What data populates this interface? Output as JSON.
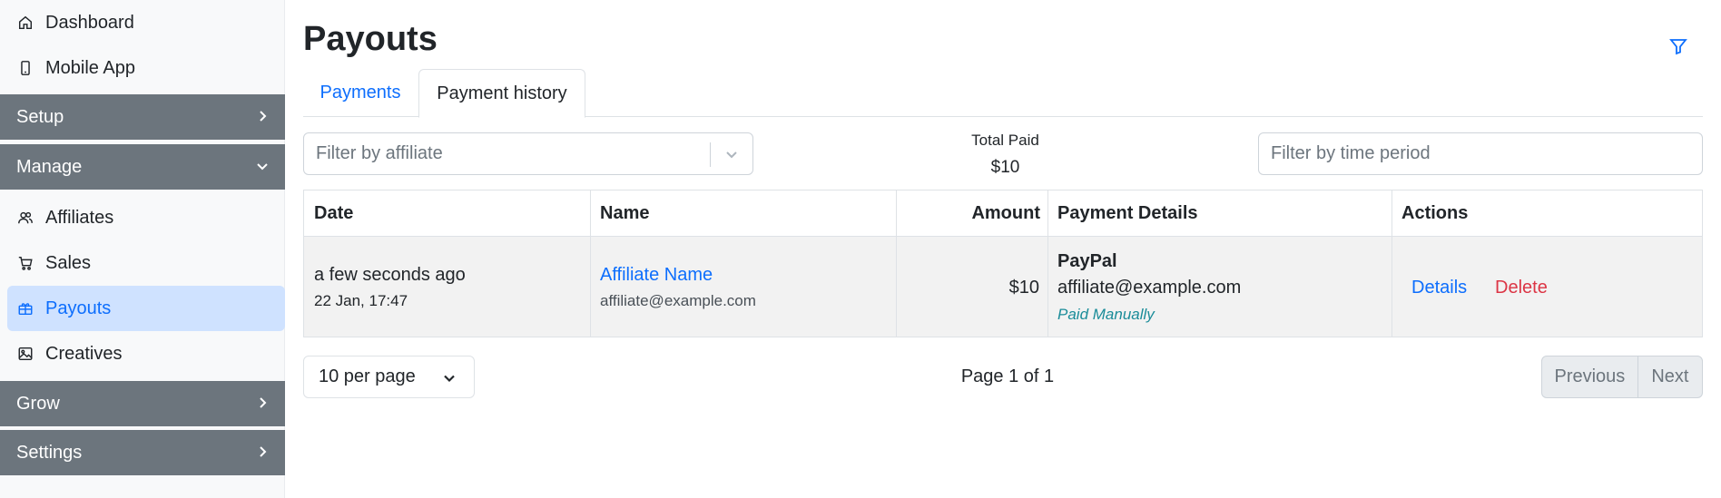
{
  "sidebar": {
    "dashboard": "Dashboard",
    "mobile_app": "Mobile App",
    "setup": "Setup",
    "manage": "Manage",
    "affiliates": "Affiliates",
    "sales": "Sales",
    "payouts": "Payouts",
    "creatives": "Creatives",
    "grow": "Grow",
    "settings": "Settings"
  },
  "page": {
    "title": "Payouts",
    "tabs": [
      "Payments",
      "Payment history"
    ],
    "active_tab": "Payment history"
  },
  "filters": {
    "affiliate_placeholder": "Filter by affiliate",
    "period_placeholder": "Filter by time period",
    "total_paid_label": "Total Paid",
    "total_paid_value": "$10"
  },
  "table": {
    "headers": [
      "Date",
      "Name",
      "Amount",
      "Payment Details",
      "Actions"
    ],
    "rows": [
      {
        "date_relative": "a few seconds ago",
        "date_exact": "22 Jan, 17:47",
        "name": "Affiliate Name",
        "email": "affiliate@example.com",
        "amount": "$10",
        "method": "PayPal",
        "method_account": "affiliate@example.com",
        "status": "Paid Manually",
        "actions": [
          "Details",
          "Delete"
        ]
      }
    ]
  },
  "pagination": {
    "per_page": "10 per page",
    "page_info": "Page 1 of 1",
    "previous": "Previous",
    "next": "Next"
  },
  "colors": {
    "accent": "#0d6efd",
    "danger": "#dc3545",
    "section_bg": "#6c757d",
    "active_bg": "#cfe2ff",
    "status_teal": "#1a8c99"
  }
}
